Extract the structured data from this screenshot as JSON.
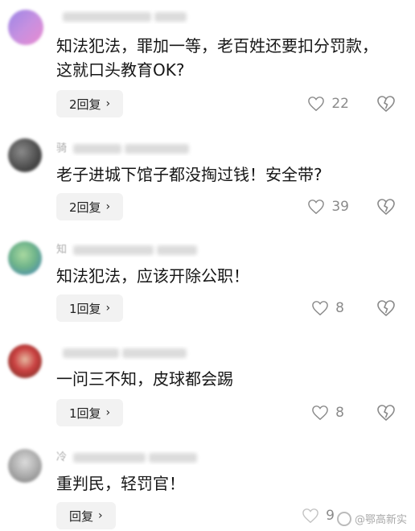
{
  "comments": [
    {
      "author_initial": "",
      "text_line1": "知法犯法，罪加一等，老百姓还要扣分罚款，",
      "text_line2": "这就口头教育OK?",
      "reply_label": "2回复",
      "likes": "22",
      "avatar_colors": [
        "#9b86e6",
        "#e98ad0"
      ]
    },
    {
      "author_initial": "骑",
      "text_line1": "老子进城下馆子都没掏过钱！安全带?",
      "text_line2": "",
      "reply_label": "2回复",
      "likes": "39",
      "avatar_colors": [
        "#6b6b6b",
        "#3a3a3a"
      ]
    },
    {
      "author_initial": "知",
      "text_line1": "知法犯法，应该开除公职！",
      "text_line2": "",
      "reply_label": "1回复",
      "likes": "8",
      "avatar_colors": [
        "#9fd19a",
        "#4e8fbf"
      ]
    },
    {
      "author_initial": "",
      "text_line1": "一问三不知，皮球都会踢",
      "text_line2": "",
      "reply_label": "1回复",
      "likes": "8",
      "avatar_colors": [
        "#c93d3d",
        "#7a3a2a"
      ]
    },
    {
      "author_initial": "冷",
      "text_line1": "重判民，轻罚官！",
      "text_line2": "",
      "reply_label": "回复",
      "likes": "9",
      "avatar_colors": [
        "#c8c8c8",
        "#8a8a8a"
      ]
    }
  ],
  "watermark": {
    "text": "@鄂高新实"
  },
  "icons": {
    "like": "heart-icon",
    "dislike": "broken-heart-icon",
    "reply_chevron": "chevron-right-icon"
  }
}
